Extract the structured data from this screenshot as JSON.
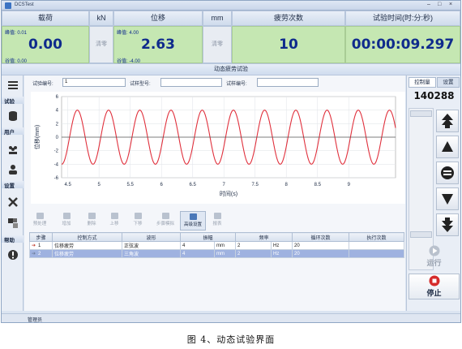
{
  "window": {
    "title": "DCSTest",
    "controls": [
      "–",
      "□",
      "×"
    ]
  },
  "readouts": {
    "load": {
      "label": "载荷",
      "unit": "kN",
      "peak": "峰值: 0.01",
      "value": "0.00",
      "valley": "谷值: 0.00",
      "zero": "清零"
    },
    "displacement": {
      "label": "位移",
      "unit": "mm",
      "peak": "峰值: 4.00",
      "value": "2.63",
      "valley": "谷值: -4.00",
      "zero": "清零"
    },
    "fatigue": {
      "label": "疲劳次数",
      "value": "10"
    },
    "time": {
      "label": "试验时间(时:分:秒)",
      "value": "00:00:09.297"
    }
  },
  "section_title": "动态疲劳试验",
  "nav": {
    "sections": [
      "试验",
      "用户",
      "设置",
      "帮助"
    ],
    "icons": [
      "menu-icon",
      "database-icon",
      "users-icon",
      "user-icon",
      "wrench-icon",
      "tiles-icon",
      "info-icon"
    ]
  },
  "inputs": {
    "test_no_label": "试验编号:",
    "test_no_value": "1",
    "specimen_type_label": "试样型号:",
    "specimen_type_value": "",
    "specimen_no_label": "试样编号:",
    "specimen_no_value": ""
  },
  "chart_data": {
    "type": "line",
    "title": "",
    "xlabel": "时间(s)",
    "ylabel": "位移(mm)",
    "xlim": [
      4.4,
      9.75
    ],
    "ylim": [
      -6,
      6
    ],
    "xticks": [
      "4.5",
      "5",
      "5.5",
      "6",
      "6.5",
      "7",
      "7.5",
      "8",
      "8.5",
      "9"
    ],
    "yticks": [
      "6",
      "4",
      "2",
      "0",
      "-2",
      "-4",
      "-6"
    ],
    "grid": true,
    "series": [
      {
        "function": "sine",
        "amplitude": 4,
        "frequency_hz": 2,
        "phase_deg": -20,
        "color": "#e0303c"
      },
      {
        "function": "constant",
        "value": 0,
        "color": "#555555"
      }
    ]
  },
  "toolbar": [
    {
      "label": "预处理",
      "icon": "preprocess-icon",
      "active": false
    },
    {
      "label": "增加",
      "icon": "add-icon",
      "active": false
    },
    {
      "label": "删除",
      "icon": "delete-icon",
      "active": false
    },
    {
      "label": "上移",
      "icon": "move-up-icon",
      "active": false
    },
    {
      "label": "下移",
      "icon": "move-down-icon",
      "active": false
    },
    {
      "label": "步骤模拟",
      "icon": "simulate-icon",
      "active": false
    },
    {
      "label": "高级设置",
      "icon": "advanced-settings-icon",
      "active": true
    },
    {
      "label": "报表",
      "icon": "report-icon",
      "active": false
    }
  ],
  "steps_table": {
    "headers": [
      "步骤",
      "控制方式",
      "波形",
      "振幅",
      "",
      "频率",
      "",
      "循环次数",
      "执行次数"
    ],
    "rows": [
      [
        "1",
        "位移疲劳",
        "正弦波",
        "4",
        "mm",
        "2",
        "Hz",
        "20",
        ""
      ],
      [
        "2",
        "位移疲劳",
        "三角波",
        "4",
        "mm",
        "2",
        "Hz",
        "20",
        ""
      ]
    ]
  },
  "right_panel": {
    "tab_control": "控制量",
    "tab_settings": "设置",
    "count": "140288",
    "run_label": "运行",
    "stop_label": "停止"
  },
  "status": {
    "user": "管理员"
  },
  "caption": "图 4、动态试验界面"
}
